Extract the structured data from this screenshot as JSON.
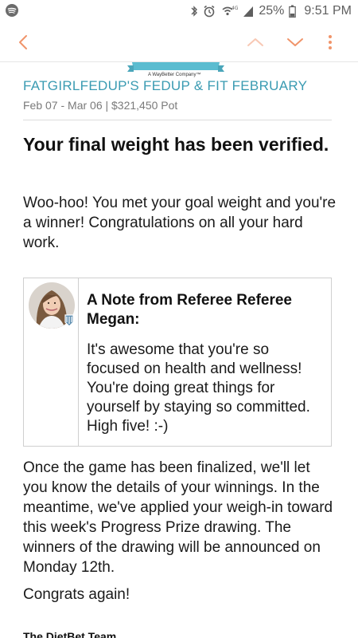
{
  "status_bar": {
    "app_icon": "spotify-icon",
    "icons": [
      "bluetooth-icon",
      "alarm-icon",
      "wifi-icon",
      "signal-icon",
      "battery-icon"
    ],
    "network_label": "4G",
    "battery": "25%",
    "time": "9:51 PM"
  },
  "toolbar": {
    "icons": [
      "back-arrow-icon",
      "previous-message-icon",
      "next-message-icon",
      "more-options-icon"
    ],
    "accent_color": "#f0946a"
  },
  "email": {
    "banner_caption": "A WayBetter Company™",
    "challenge_title": "FATGIRLFEDUP'S FEDUP & FIT FEBRUARY",
    "challenge_meta": "Feb 07 - Mar 06 | $321,450 Pot",
    "headline": "Your final weight has been verified.",
    "intro": "Woo-hoo! You met your goal weight and you're a winner! Congratulations on all your hard work.",
    "note": {
      "title": "A Note from Referee Referee Megan:",
      "body": "It's awesome that you're so focused on health and wellness! You're doing great things for yourself by staying so committed. High five! :-)"
    },
    "winnings_paragraph": "Once the game has been finalized, we'll let you know the details of your winnings. In the meantime, we've applied your weigh-in toward this week's Progress Prize drawing. The winners of the drawing will be announced on Monday 12th.",
    "congrats": "Congrats again!",
    "signoff": "The DietBet Team",
    "title_color": "#3a9bb2"
  }
}
